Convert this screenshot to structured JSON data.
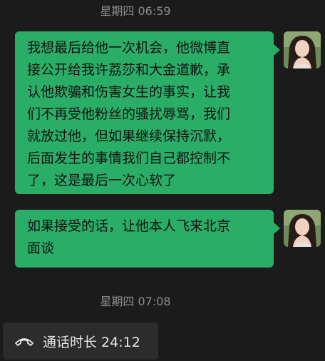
{
  "timestamps": [
    "星期四 06:59",
    "星期四 07:08"
  ],
  "messages": [
    {
      "lines": [
        "我想最后给他一次机会，他微博直",
        "接公开给我许荔莎和大金道歉，承",
        "认他欺骗和伤害女生的事实，让我",
        "们不再受他粉丝的骚扰辱骂，我们",
        "就放过他，但如果继续保持沉默，",
        "后面发生的事情我们自己都控制不",
        "了，这是最后一次心软了"
      ]
    },
    {
      "lines": [
        "如果接受的话，让他本人飞来北京",
        "面谈"
      ]
    }
  ],
  "call": {
    "icon": "phone-hangup-icon",
    "label": "通话时长 24:12"
  },
  "colors": {
    "background": "#1b1b1b",
    "bubble": "#2aae67",
    "timestamp": "#8d8d8d",
    "call_pill": "#2c2c2c"
  }
}
